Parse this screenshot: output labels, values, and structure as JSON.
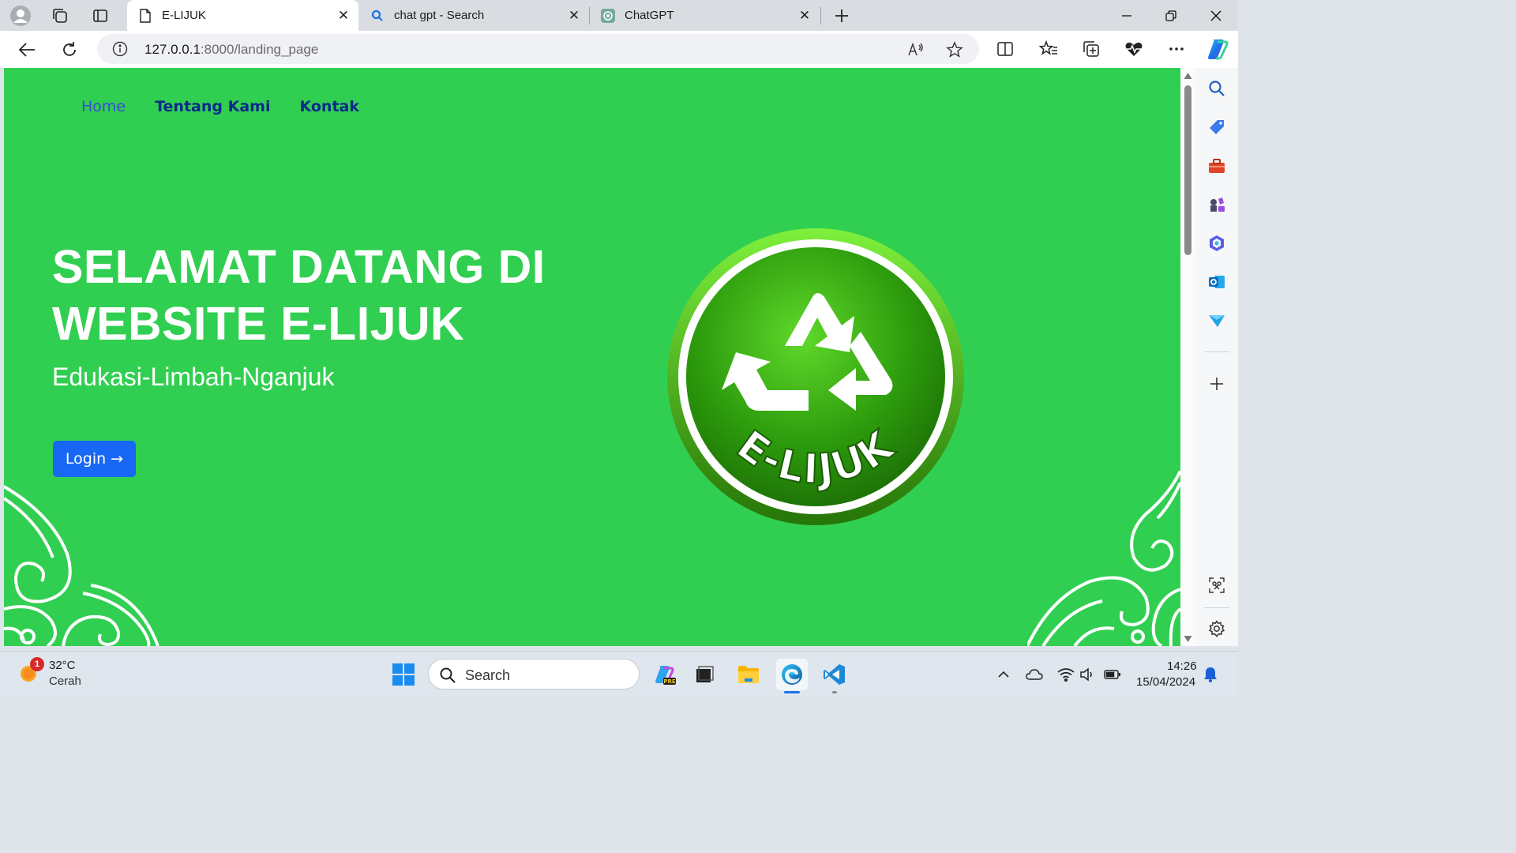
{
  "browser": {
    "tabs": [
      {
        "title": "E-LIJUK",
        "active": true,
        "icon": "page-icon"
      },
      {
        "title": "chat gpt - Search",
        "active": false,
        "icon": "search-icon"
      },
      {
        "title": "ChatGPT",
        "active": false,
        "icon": "chatgpt-icon"
      }
    ],
    "url_host": "127.0.0.1",
    "url_rest": ":8000/landing_page"
  },
  "page": {
    "nav": {
      "home": "Home",
      "about": "Tentang Kami",
      "contact": "Kontak"
    },
    "hero_title": "SELAMAT DATANG DI WEBSITE E-LIJUK",
    "hero_subtitle": "Edukasi-Limbah-Nganjuk",
    "login_label": "Login",
    "login_arrow": "→",
    "logo_text": "E-LIJUK",
    "colors": {
      "background": "#31cf51",
      "button": "#1868f5",
      "nav_link": "#0a2a8a",
      "nav_active": "#3b4ad6"
    }
  },
  "taskbar": {
    "weather_temp": "32°C",
    "weather_condition": "Cerah",
    "weather_badge": "1",
    "search_placeholder": "Search",
    "time": "14:26",
    "date": "15/04/2024"
  }
}
